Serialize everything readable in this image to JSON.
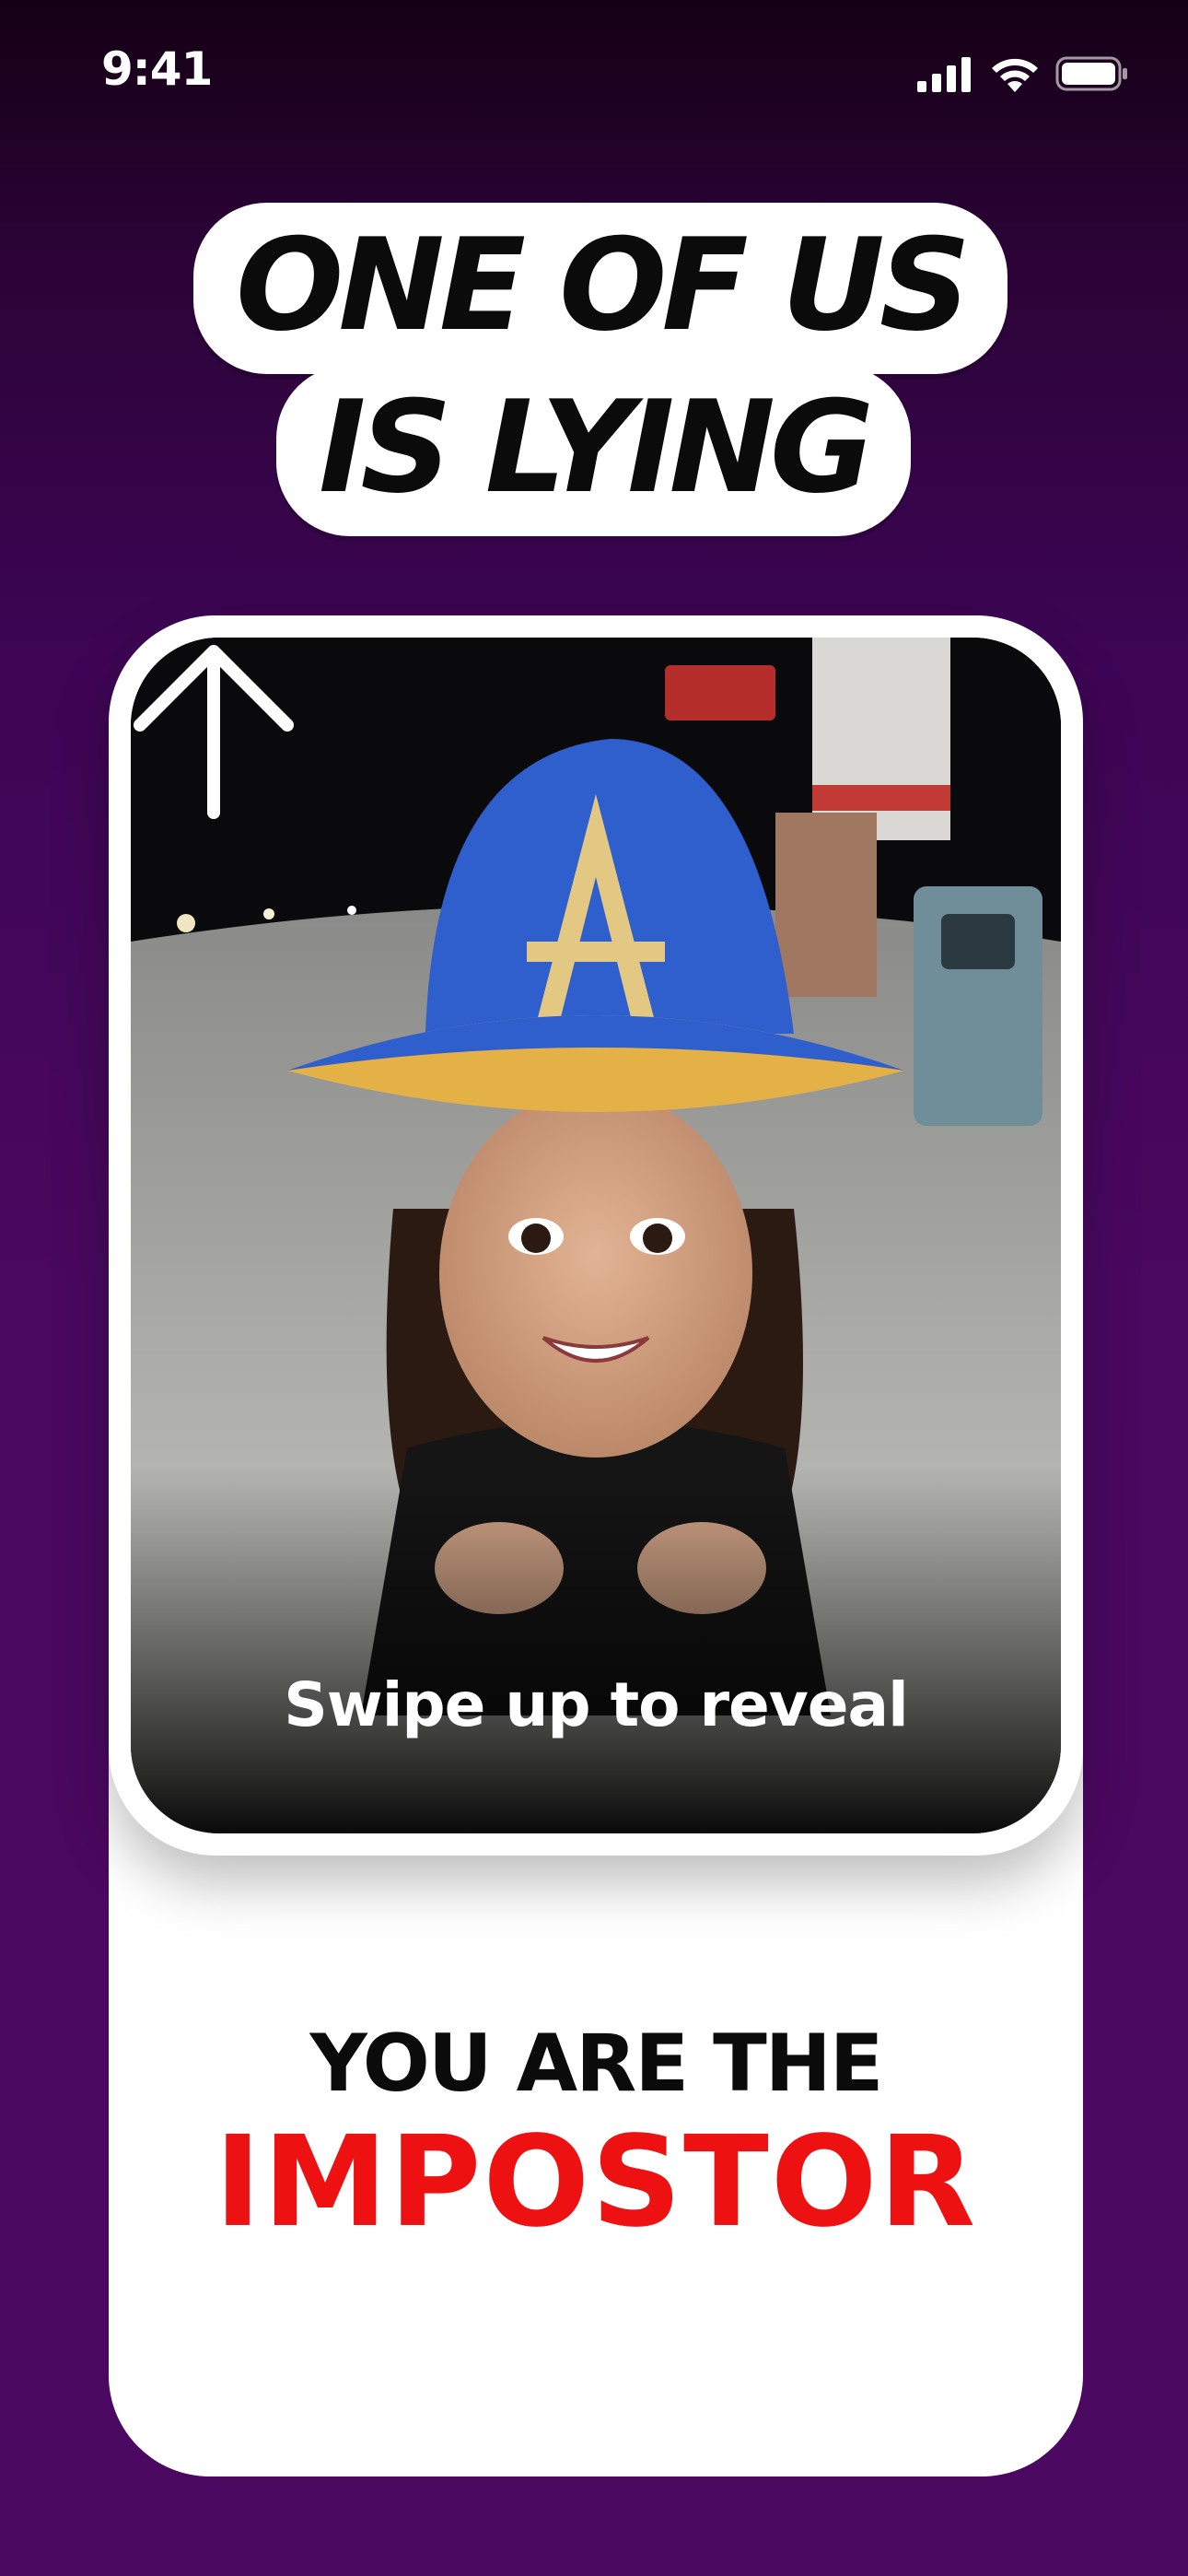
{
  "status_bar": {
    "time": "9:41",
    "icons": [
      "cellular-signal-icon",
      "wifi-icon",
      "battery-icon"
    ]
  },
  "headline": {
    "line1": "ONE OF US",
    "line2": "IS LYING"
  },
  "reveal_card": {
    "photo": "player-photo",
    "gesture_icon": "arrow-up-icon",
    "instruction": "Swipe up to reveal"
  },
  "result": {
    "prefix": "YOU ARE THE",
    "role": "IMPOSTOR"
  },
  "colors": {
    "background": "#4a0860",
    "role_text": "#ee1111",
    "card": "#ffffff"
  }
}
